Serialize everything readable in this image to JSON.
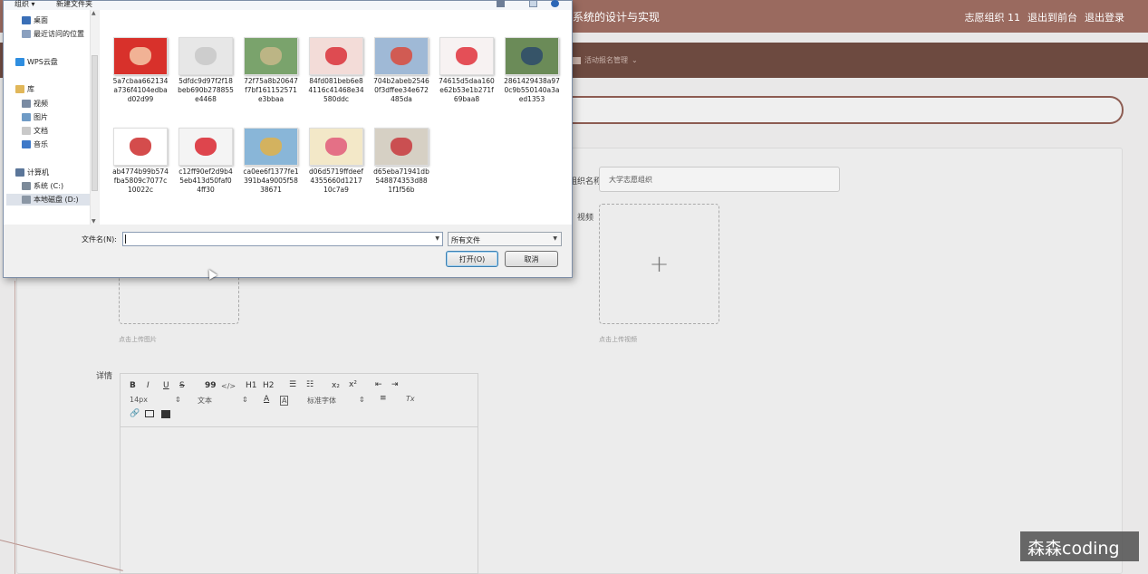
{
  "app": {
    "title": "系统的设计与实现",
    "user_label": "志愿组织 11",
    "back_to_front": "退出到前台",
    "logout": "退出登录",
    "nav_item": "活动报名管理"
  },
  "form": {
    "name_label": "组织名称",
    "name_value": "大学志愿组织",
    "video_label": "视频",
    "upload_image_hint": "点击上传图片",
    "upload_video_hint": "点击上传视频",
    "detail_label": "详情",
    "plus": "+"
  },
  "editor": {
    "bold": "B",
    "italic": "I",
    "underline": "U",
    "strike": "S",
    "quote": "99",
    "code": "</>",
    "h1": "H1",
    "h2": "H2",
    "ordered_list": "☰",
    "bullet_list": "☷",
    "sub": "x₂",
    "sup": "x²",
    "outdent": "⇤",
    "indent": "⇥",
    "font_size": "14px",
    "text_type": "文本",
    "font_family": "标准字体",
    "align": "≡",
    "clear": "Tx"
  },
  "dialog": {
    "organize": "组织 ▾",
    "new_folder": "新建文件夹",
    "sidebar": [
      {
        "label": "桌面",
        "color": "#3a6fb7"
      },
      {
        "label": "最近访问的位置",
        "color": "#8aa0bf"
      },
      {
        "label": "WPS云盘",
        "color": "#2f8ee0"
      },
      {
        "label": "库",
        "color": "#e1b75a"
      },
      {
        "label": "视频",
        "color": "#7a8ba3"
      },
      {
        "label": "图片",
        "color": "#6f9bc6"
      },
      {
        "label": "文档",
        "color": "#c9c9c9"
      },
      {
        "label": "音乐",
        "color": "#3d78c8"
      },
      {
        "label": "计算机",
        "color": "#5b7699"
      },
      {
        "label": "系统 (C:)",
        "color": "#7c8a99"
      },
      {
        "label": "本地磁盘 (D:)",
        "color": "#8b97a5"
      }
    ],
    "files": [
      {
        "name": "5a7cbaa662134a736f4104edbad02d99",
        "bg": "#d8312b",
        "fg": "#f6c9a8"
      },
      {
        "name": "5dfdc9d97f2f18beb690b278855e4468",
        "bg": "#e7e7e7",
        "fg": "#c8c8c8"
      },
      {
        "name": "72f75a8b20647f7bf161152571e3bbaa",
        "bg": "#7aa36c",
        "fg": "#c8b889"
      },
      {
        "name": "84fd081beb6e84116c41468e34580ddc",
        "bg": "#f3dcd8",
        "fg": "#d9313a"
      },
      {
        "name": "704b2abeb25460f3dffee34e672485da",
        "bg": "#9fb9d6",
        "fg": "#d94a3c"
      },
      {
        "name": "74615d5daa160e62b53e1b271f69baa8",
        "bg": "#f7f2f2",
        "fg": "#e0333c"
      },
      {
        "name": "2861429438a970c9b550140a3aed1353",
        "bg": "#6b8b58",
        "fg": "#2d4a6b"
      },
      {
        "name": "ab4774b99b574fba5809c7077c10022c",
        "bg": "#ffffff",
        "fg": "#cc2d2d"
      },
      {
        "name": "c12ff90ef2d9b45eb413d50faf04ff30",
        "bg": "#f4f4f4",
        "fg": "#d9262f"
      },
      {
        "name": "ca0ee6f1377fe1391b4a9005f5838671",
        "bg": "#89b6d8",
        "fg": "#e0b14a"
      },
      {
        "name": "d06d5719ffdeef4355660d121710c7a9",
        "bg": "#f3e8c8",
        "fg": "#e05b7a"
      },
      {
        "name": "d65eba71941db548874353d881f1f56b",
        "bg": "#d6d0c4",
        "fg": "#c8383d"
      }
    ],
    "filename_label": "文件名(N):",
    "filename_value": "",
    "filetype": "所有文件",
    "open_button": "打开(O)",
    "cancel_button": "取消"
  },
  "watermark": "森森coding"
}
